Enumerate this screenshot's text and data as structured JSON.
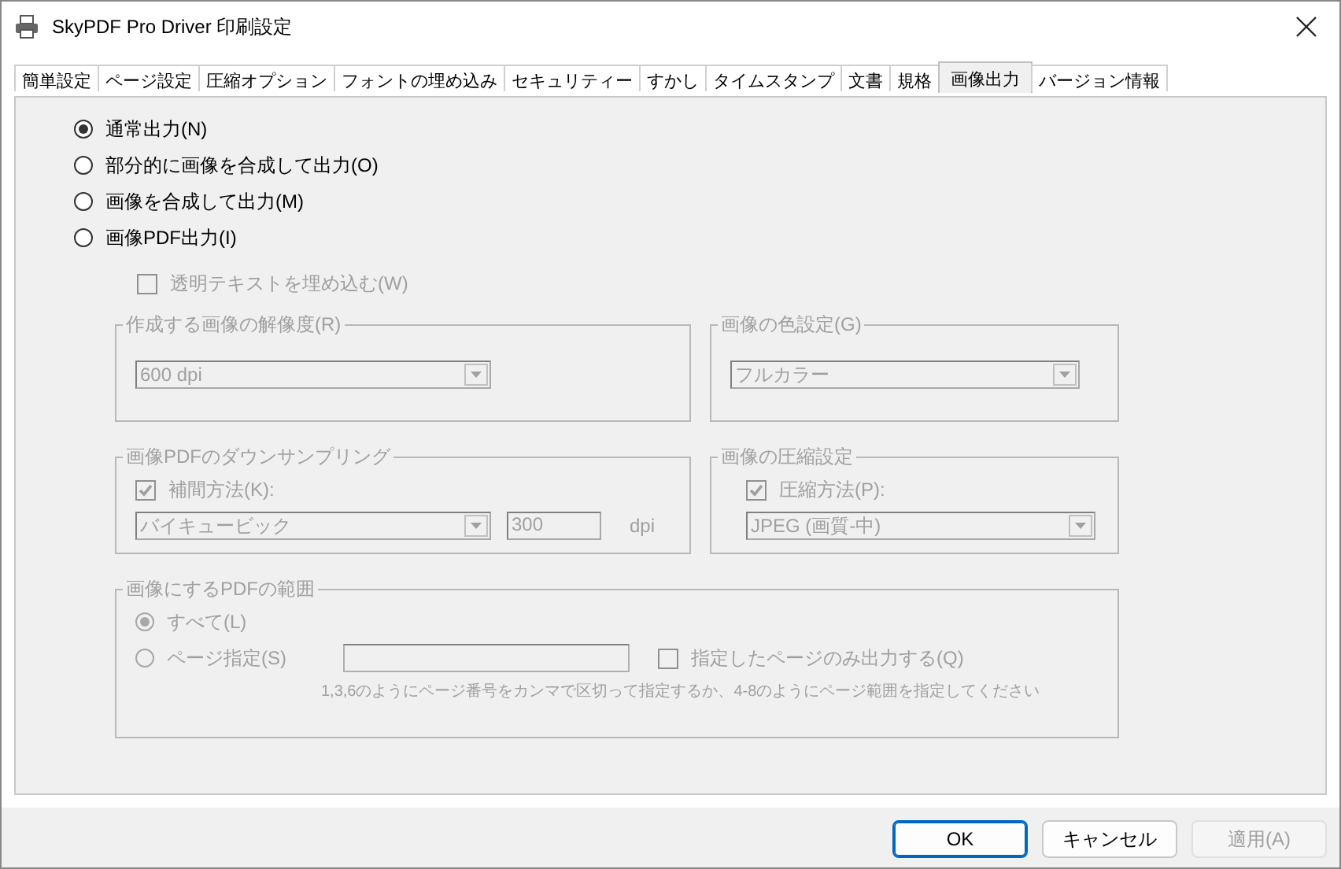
{
  "window": {
    "title": "SkyPDF Pro Driver 印刷設定"
  },
  "tabs": [
    {
      "label": "簡単設定",
      "selected": false
    },
    {
      "label": "ページ設定",
      "selected": false
    },
    {
      "label": "圧縮オプション",
      "selected": false
    },
    {
      "label": "フォントの埋め込み",
      "selected": false
    },
    {
      "label": "セキュリティー",
      "selected": false
    },
    {
      "label": "すかし",
      "selected": false
    },
    {
      "label": "タイムスタンプ",
      "selected": false
    },
    {
      "label": "文書",
      "selected": false
    },
    {
      "label": "規格",
      "selected": false
    },
    {
      "label": "画像出力",
      "selected": true
    },
    {
      "label": "バージョン情報",
      "selected": false
    }
  ],
  "output_modes": [
    {
      "label": "通常出力(N)",
      "selected": true
    },
    {
      "label": "部分的に画像を合成して出力(O)",
      "selected": false
    },
    {
      "label": "画像を合成して出力(M)",
      "selected": false
    },
    {
      "label": "画像PDF出力(I)",
      "selected": false
    }
  ],
  "options_disabled": true,
  "embed_text": {
    "label": "透明テキストを埋め込む(W)",
    "checked": false
  },
  "resolution": {
    "title": "作成する画像の解像度(R)",
    "value": "600 dpi"
  },
  "color": {
    "title": "画像の色設定(G)",
    "value": "フルカラー"
  },
  "downsampling": {
    "title": "画像PDFのダウンサンプリング",
    "interpolation": {
      "label": "補間方法(K):",
      "checked": true
    },
    "method": "バイキュービック",
    "dpi_value": "300",
    "dpi_unit": "dpi"
  },
  "compression": {
    "title": "画像の圧縮設定",
    "method_checkbox": {
      "label": "圧縮方法(P):",
      "checked": true
    },
    "value": "JPEG (画質-中)"
  },
  "range": {
    "title": "画像にするPDFの範囲",
    "options": [
      {
        "label": "すべて(L)",
        "selected": true
      },
      {
        "label": "ページ指定(S)",
        "selected": false
      }
    ],
    "only_pages": {
      "label": "指定したページのみ出力する(Q)",
      "checked": false
    },
    "hint": "1,3,6のようにページ番号をカンマで区切って指定するか、4-8のようにページ範囲を指定してください"
  },
  "buttons": [
    {
      "label": "OK",
      "kind": "default",
      "disabled": false
    },
    {
      "label": "キャンセル",
      "kind": "normal",
      "disabled": false
    },
    {
      "label": "適用(A)",
      "kind": "normal",
      "disabled": true
    }
  ]
}
